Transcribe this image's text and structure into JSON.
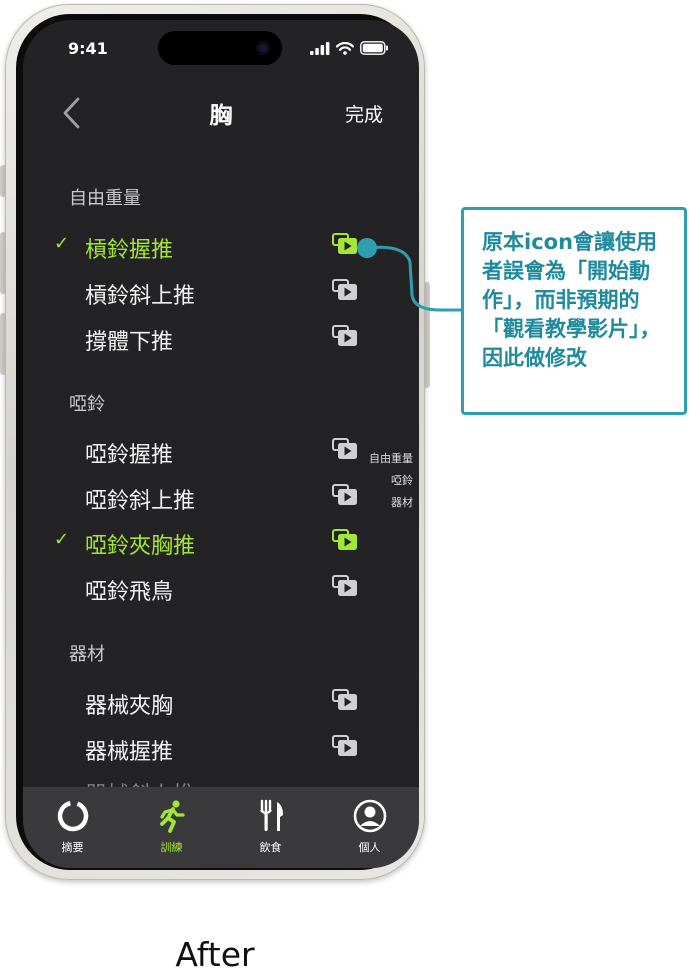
{
  "status_bar": {
    "time": "9:41"
  },
  "nav": {
    "title": "胸",
    "done_label": "完成"
  },
  "sections": [
    {
      "title": "自由重量",
      "items": [
        {
          "label": "槓鈴握推",
          "selected": true
        },
        {
          "label": "槓鈴斜上推",
          "selected": false
        },
        {
          "label": "撐體下推",
          "selected": false
        }
      ]
    },
    {
      "title": "啞鈴",
      "items": [
        {
          "label": "啞鈴握推",
          "selected": false
        },
        {
          "label": "啞鈴斜上推",
          "selected": false
        },
        {
          "label": "啞鈴夾胸推",
          "selected": true
        },
        {
          "label": "啞鈴飛鳥",
          "selected": false
        }
      ]
    },
    {
      "title": "器材",
      "items": [
        {
          "label": "器械夾胸",
          "selected": false
        },
        {
          "label": "器械握推",
          "selected": false
        },
        {
          "label": "器械斜上推",
          "selected": false
        }
      ]
    }
  ],
  "section_index": [
    "自由重量",
    "啞鈴",
    "器材"
  ],
  "tabs": [
    {
      "label": "摘要",
      "icon": "activity-ring-icon",
      "active": false
    },
    {
      "label": "訓練",
      "icon": "running-figure-icon",
      "active": true
    },
    {
      "label": "飲食",
      "icon": "fork-knife-icon",
      "active": false
    },
    {
      "label": "個人",
      "icon": "person-circle-icon",
      "active": false
    }
  ],
  "annotation": {
    "text": "原本icon會讓使用者誤會為「開始動作」，而非預期的「觀看教學影片」，因此做修改"
  },
  "caption": "After",
  "colors": {
    "accent": "#a3e635",
    "screen_bg": "#232325",
    "tab_bar_bg": "#3a3a3c",
    "callout_border": "#2f9fb0",
    "callout_text": "#1f8a9c"
  }
}
